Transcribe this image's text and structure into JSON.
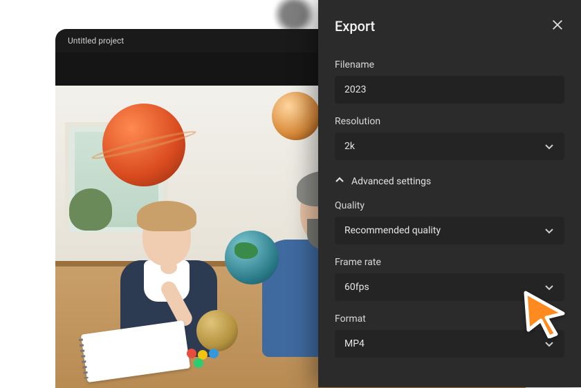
{
  "editor": {
    "project_title": "Untitled project"
  },
  "panel": {
    "title": "Export",
    "filename_label": "Filename",
    "filename_value": "2023",
    "resolution_label": "Resolution",
    "resolution_value": "2k",
    "advanced_label": "Advanced settings",
    "quality_label": "Quality",
    "quality_value": "Recommended quality",
    "framerate_label": "Frame rate",
    "framerate_value": "60fps",
    "format_label": "Format",
    "format_value": "MP4"
  }
}
